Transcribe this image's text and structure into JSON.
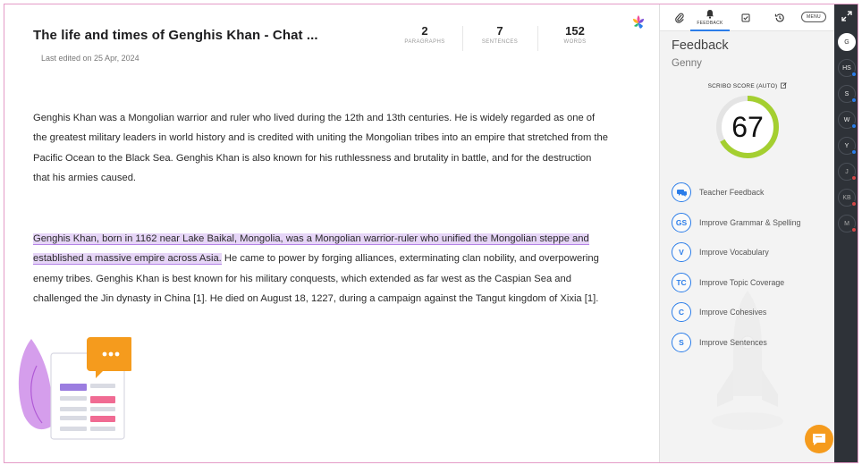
{
  "document": {
    "title": "The life and times of Genghis Khan - Chat ...",
    "last_edited": "Last edited on 25 Apr, 2024",
    "stats": [
      {
        "value": "2",
        "label": "PARAGRAPHS"
      },
      {
        "value": "7",
        "label": "SENTENCES"
      },
      {
        "value": "152",
        "label": "WORDS"
      }
    ],
    "paragraph1": "Genghis Khan was a Mongolian warrior and ruler who lived during the 12th and 13th centuries. He is widely regarded as one of the greatest military leaders in world history and is credited with uniting the Mongolian tribes into an empire that stretched from the Pacific Ocean to the Black Sea. Genghis Khan is also known for his ruthlessness and brutality in battle, and for the destruction that his armies caused.",
    "paragraph2_highlighted": "Genghis Khan, born in 1162 near Lake Baikal, Mongolia, was a Mongolian warrior-ruler who unified the Mongolian steppe and established a massive empire across Asia.",
    "paragraph2_rest": " He came to power by forging alliances, exterminating clan nobility, and overpowering enemy tribes. Genghis Khan is best known for his military conquests, which extended as far west as the Caspian Sea and challenged the Jin dynasty in China [1]. He died on August 18, 1227, during a campaign against the Tangut kingdom of Xixia [1]."
  },
  "panel": {
    "toolbar": {
      "feedback_label": "FEEDBACK",
      "menu_label": "MENU"
    },
    "title": "Feedback",
    "subtitle": "Genny",
    "score_label": "SCRIBO SCORE (AUTO)",
    "score": "67",
    "score_fraction": 0.67,
    "items": [
      {
        "badge": "",
        "label": "Teacher Feedback"
      },
      {
        "badge": "GS",
        "label": "Improve Grammar & Spelling"
      },
      {
        "badge": "V",
        "label": "Improve Vocabulary"
      },
      {
        "badge": "TC",
        "label": "Improve Topic Coverage"
      },
      {
        "badge": "C",
        "label": "Improve Cohesives"
      },
      {
        "badge": "S",
        "label": "Improve Sentences"
      }
    ]
  },
  "rail": {
    "avatars": [
      {
        "initials": "G",
        "status": "none"
      },
      {
        "initials": "HS",
        "status": "blue"
      },
      {
        "initials": "S",
        "status": "blue"
      },
      {
        "initials": "W",
        "status": "blue"
      },
      {
        "initials": "Y",
        "status": "blue"
      },
      {
        "initials": "J",
        "status": "red"
      },
      {
        "initials": "KB",
        "status": "red"
      },
      {
        "initials": "M",
        "status": "red"
      }
    ]
  },
  "colors": {
    "accent": "#2b7de9",
    "score_ring": "#a4cf30",
    "highlight": "#e6d5f7",
    "chat_button": "#f59b1d",
    "rail_bg": "#2e3238"
  }
}
